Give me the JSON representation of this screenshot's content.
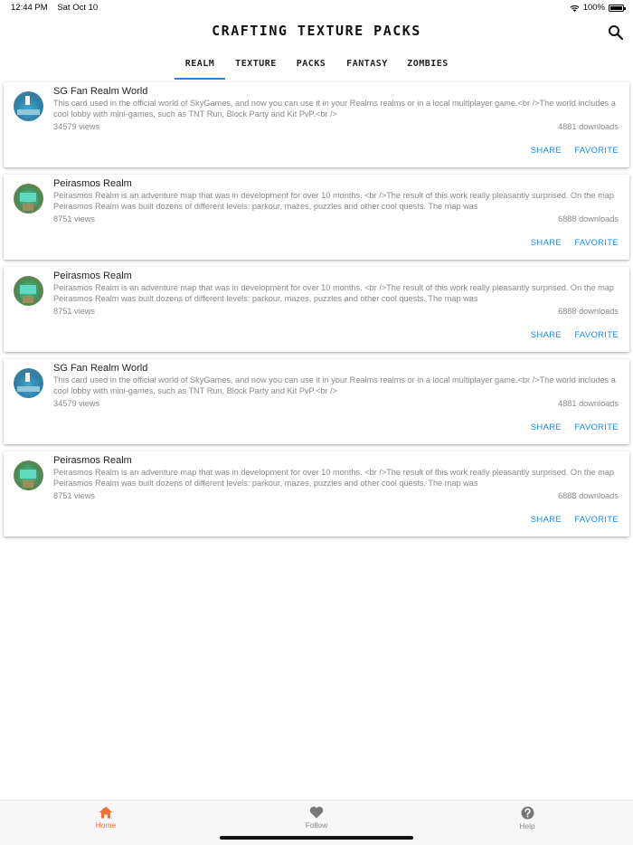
{
  "status_bar": {
    "time": "12:44 PM",
    "date": "Sat Oct 10",
    "battery": "100%"
  },
  "header": {
    "title": "CRAFTING TEXTURE PACKS",
    "search_icon": "search-icon"
  },
  "tabs": [
    {
      "label": "REALM",
      "active": true
    },
    {
      "label": "TEXTURE",
      "active": false
    },
    {
      "label": "PACKS",
      "active": false
    },
    {
      "label": "FANTASY",
      "active": false
    },
    {
      "label": "ZOMBIES",
      "active": false
    }
  ],
  "accent_color": "#1e88e5",
  "nav_active_color": "#f2703a",
  "cards": [
    {
      "title": "SG Fan Realm World",
      "description": "This card used in the official world of SkyGames, and now you can use it in your Realms realms or in a local multiplayer game.<br />The world includes a cool lobby with mini-games, such as TNT Run, Block Party and Kit PvP.<br />",
      "views": "34579 views",
      "downloads": "4881 downloads",
      "share": "SHARE",
      "favorite": "FAVORITE"
    },
    {
      "title": "Peirasmos Realm",
      "description": "Peirasmos Realm is an adventure map that was in development for over 10 months. <br />The result of this work really pleasantly surprised. On the map Peirasmos Realm was built dozens of different levels: parkour, mazes, puzzles and other cool quests. The map was",
      "views": "8751 views",
      "downloads": "6888 downloads",
      "share": "SHARE",
      "favorite": "FAVORITE"
    },
    {
      "title": "Peirasmos Realm",
      "description": "Peirasmos Realm is an adventure map that was in development for over 10 months. <br />The result of this work really pleasantly surprised. On the map Peirasmos Realm was built dozens of different levels: parkour, mazes, puzzles and other cool quests. The map was",
      "views": "8751 views",
      "downloads": "6888 downloads",
      "share": "SHARE",
      "favorite": "FAVORITE"
    },
    {
      "title": "SG Fan Realm World",
      "description": "This card used in the official world of SkyGames, and now you can use it in your Realms realms or in a local multiplayer game.<br />The world includes a cool lobby with mini-games, such as TNT Run, Block Party and Kit PvP.<br />",
      "views": "34579 views",
      "downloads": "4881 downloads",
      "share": "SHARE",
      "favorite": "FAVORITE"
    },
    {
      "title": "Peirasmos Realm",
      "description": "Peirasmos Realm is an adventure map that was in development for over 10 months. <br />The result of this work really pleasantly surprised. On the map Peirasmos Realm was built dozens of different levels: parkour, mazes, puzzles and other cool quests. The map was",
      "views": "8751 views",
      "downloads": "6888 downloads",
      "share": "SHARE",
      "favorite": "FAVORITE"
    }
  ],
  "bottom_nav": [
    {
      "label": "Home",
      "icon": "home-icon",
      "active": true
    },
    {
      "label": "Follow",
      "icon": "heart-icon",
      "active": false
    },
    {
      "label": "Help",
      "icon": "help-icon",
      "active": false
    }
  ]
}
